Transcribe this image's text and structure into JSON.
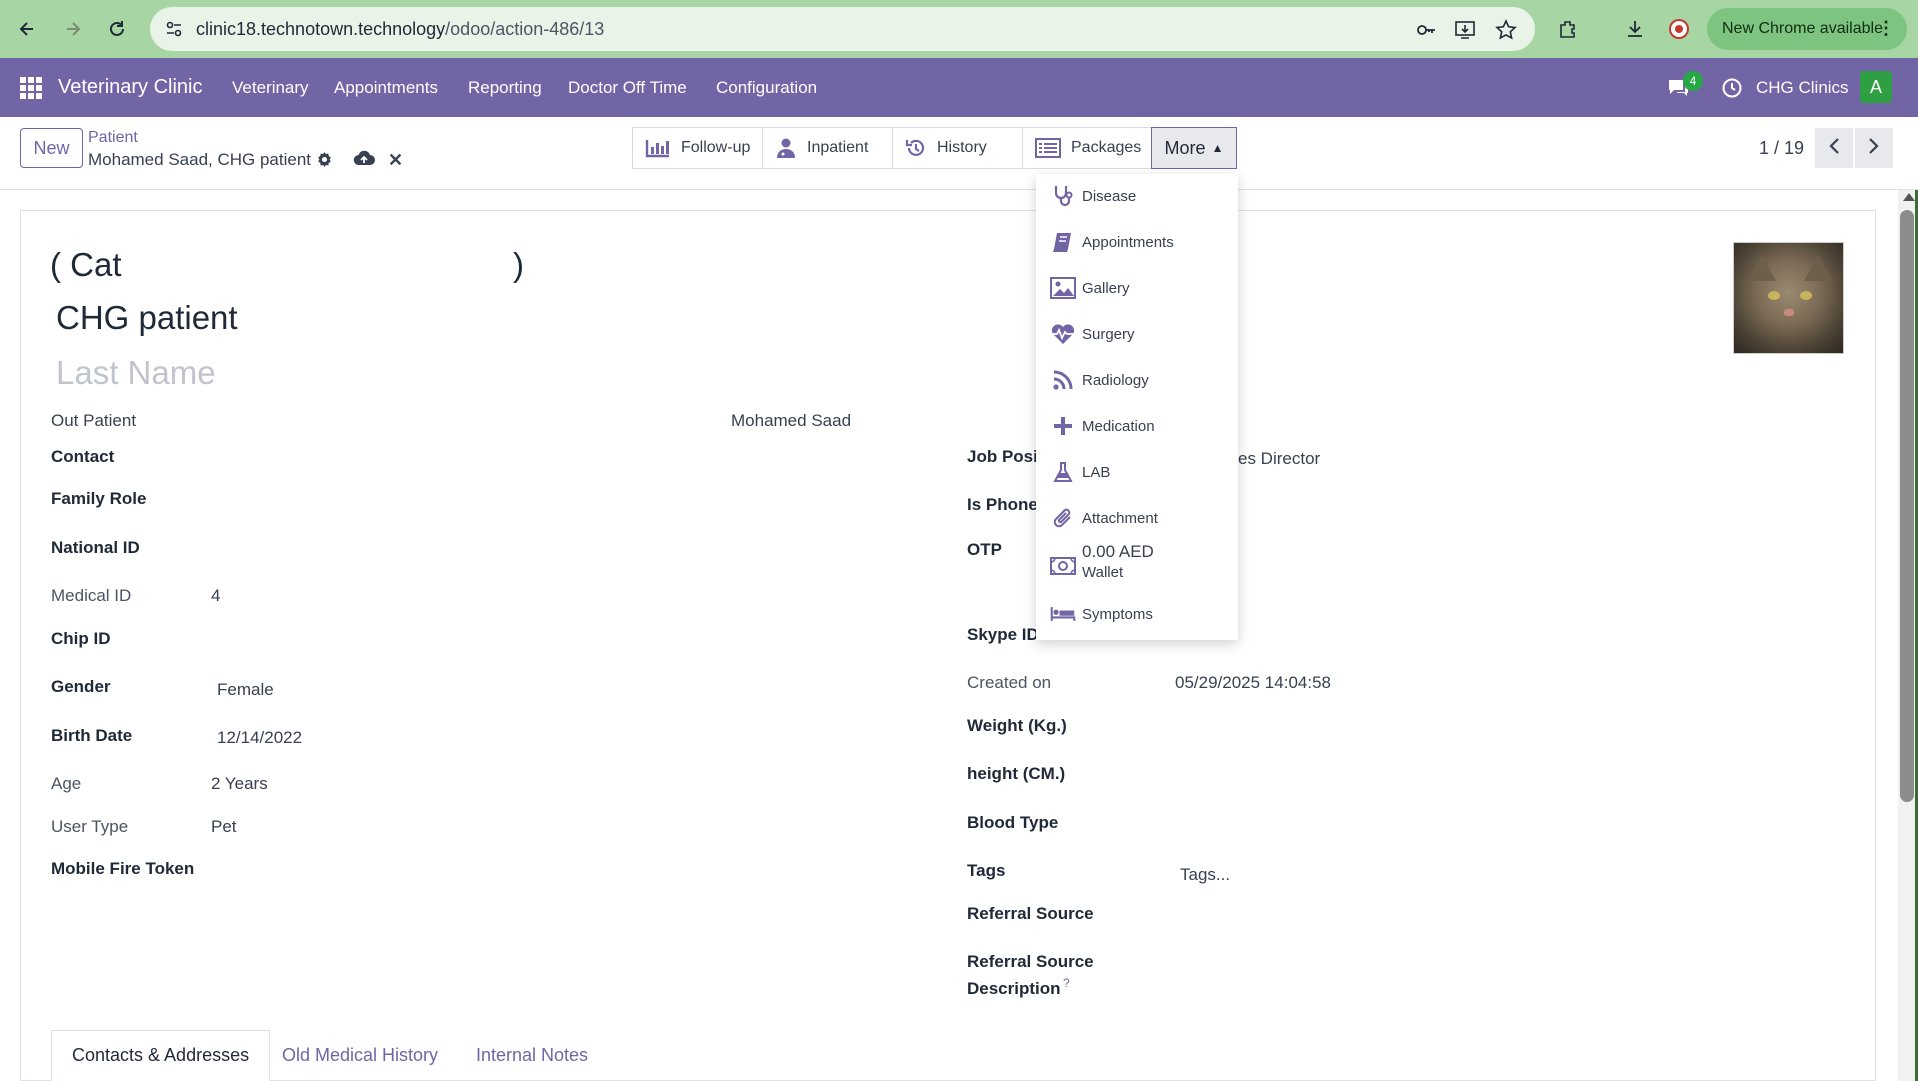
{
  "browser": {
    "url_host": "clinic18.technotown.technology",
    "url_path": "/odoo/action-486/13",
    "update_label": "New Chrome available"
  },
  "navbar": {
    "brand": "Veterinary Clinic",
    "menu": [
      "Veterinary",
      "Appointments",
      "Reporting",
      "Doctor Off Time",
      "Configuration"
    ],
    "chat_count": "4",
    "company": "CHG Clinics",
    "avatar_letter": "A"
  },
  "control": {
    "new_label": "New",
    "breadcrumb": "Patient",
    "record_name": "Mohamed Saad, CHG patient",
    "smart_buttons": [
      "Follow-up",
      "Inpatient",
      "History",
      "Packages"
    ],
    "more_label": "More",
    "pager": "1 / 19"
  },
  "dropdown": {
    "items": [
      {
        "label": "Disease",
        "icon": "stethoscope-icon"
      },
      {
        "label": "Appointments",
        "icon": "book-icon"
      },
      {
        "label": "Gallery",
        "icon": "image-icon"
      },
      {
        "label": "Surgery",
        "icon": "heartbeat-icon"
      },
      {
        "label": "Radiology",
        "icon": "rss-icon"
      },
      {
        "label": "Medication",
        "icon": "plus-icon"
      },
      {
        "label": "LAB",
        "icon": "flask-icon"
      },
      {
        "label": "Attachment",
        "icon": "paperclip-icon"
      },
      {
        "label": "0.00 AED",
        "sublabel": "Wallet",
        "icon": "money-icon"
      },
      {
        "label": "Symptoms",
        "icon": "bed-icon"
      }
    ]
  },
  "form": {
    "title_open": "( Cat",
    "title_close": ")",
    "first_name": "CHG patient",
    "last_name_placeholder": "Last Name",
    "patient_type": "Out Patient",
    "owner": "Mohamed Saad",
    "left": {
      "contact_label": "Contact",
      "family_role_label": "Family Role",
      "national_id_label": "National ID",
      "medical_id_label": "Medical ID",
      "medical_id_value": "4",
      "chip_id_label": "Chip ID",
      "gender_label": "Gender",
      "gender_value": "Female",
      "birth_date_label": "Birth Date",
      "birth_date_value": "12/14/2022",
      "age_label": "Age",
      "age_value": "2 Years",
      "user_type_label": "User Type",
      "user_type_value": "Pet",
      "mobile_token_label": "Mobile Fire Token"
    },
    "right": {
      "job_position_label": "Job Posit",
      "job_position_placeholder": "es Director",
      "is_phone_label": "Is Phone",
      "otp_label": "OTP",
      "skype_label": "Skype ID",
      "created_on_label": "Created on",
      "created_on_value": "05/29/2025 14:04:58",
      "weight_label": "Weight (Kg.)",
      "height_label": "height (CM.)",
      "blood_type_label": "Blood Type",
      "tags_label": "Tags",
      "tags_placeholder": "Tags...",
      "referral_label": "Referral Source",
      "referral_desc_label_1": "Referral Source",
      "referral_desc_label_2": "Description",
      "help_mark": "?"
    },
    "tabs": [
      "Contacts & Addresses",
      "Old Medical History",
      "Internal Notes"
    ]
  },
  "colors": {
    "primary": "#7165a6",
    "chrome_bar": "#a8d5a4",
    "new_chrome_btn": "#7cc47f"
  }
}
